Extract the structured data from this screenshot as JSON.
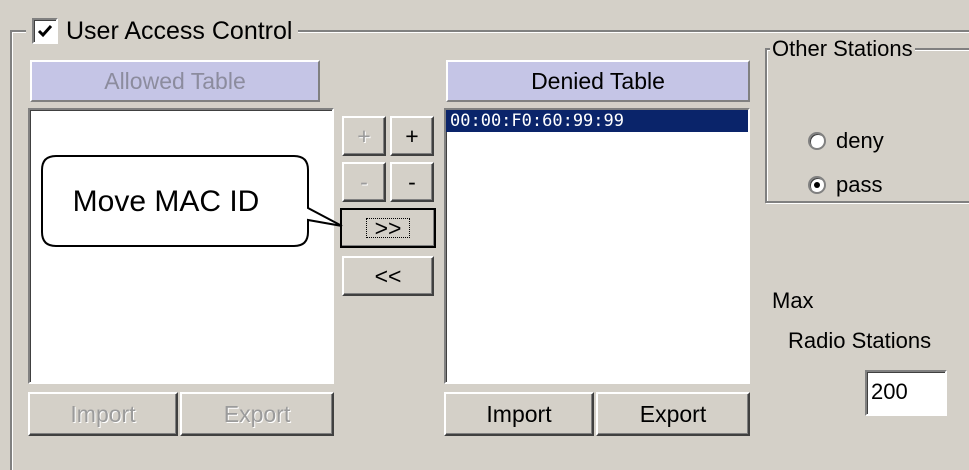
{
  "group": {
    "title": "User Access Control",
    "checked": true
  },
  "allowed": {
    "header": "Allowed Table",
    "import_label": "Import",
    "export_label": "Export"
  },
  "denied": {
    "header": "Denied Table",
    "items": [
      "00:00:F0:60:99:99"
    ],
    "import_label": "Import",
    "export_label": "Export"
  },
  "mid_buttons": {
    "plus_left": "+",
    "plus_right": "+",
    "minus_left": "-",
    "minus_right": "-",
    "move_right": ">>",
    "move_left": "<<"
  },
  "other_stations": {
    "title": "Other Stations",
    "options": [
      "deny",
      "pass"
    ],
    "selected": "pass"
  },
  "max_stations": {
    "label_line1": "Max",
    "label_line2": "Radio Stations",
    "value": "200"
  },
  "callout": {
    "text": "Move MAC ID"
  },
  "colors": {
    "background": "#d4d0c8",
    "header_bg": "#c5c5e6",
    "selection_bg": "#0a246a"
  }
}
